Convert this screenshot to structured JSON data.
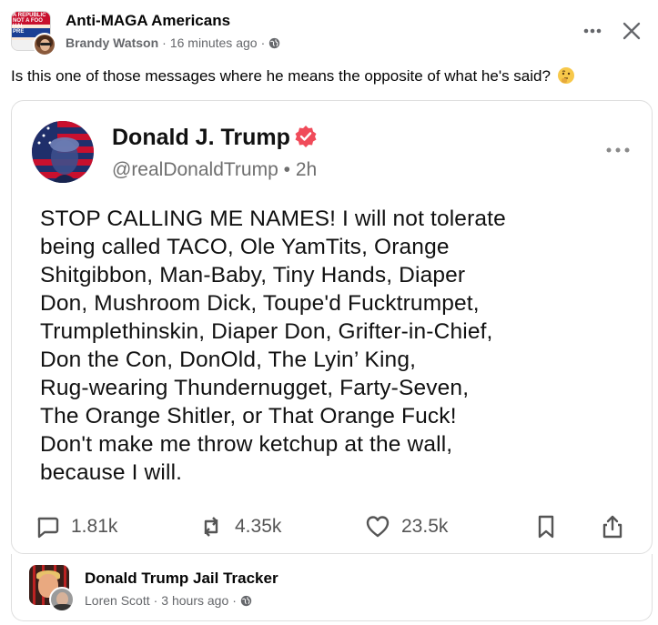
{
  "post": {
    "group_name": "Anti-MAGA Americans",
    "author": "Brandy Watson",
    "separator": "·",
    "time": "16 minutes ago",
    "separator2": "·",
    "caption": "Is this one of those messages where he means the opposite of what he's said?",
    "caption_emoji_icon": "thinking-face-icon",
    "group_avatar_text": "A REPUBLIC\nNOT A FOO\nHAI\nPRE"
  },
  "truth_post": {
    "name": "Donald J. Trump",
    "handle": "@realDonaldTrump",
    "bullet": "•",
    "time": "2h",
    "lines": [
      "STOP CALLING ME NAMES! I will not tolerate",
      "being called TACO, Ole YamTits, Orange",
      "Shitgibbon, Man-Baby, Tiny Hands, Diaper",
      "Don, Mushroom Dick, Toupe'd Fucktrumpet,",
      "Trumplethinskin, Diaper Don, Grifter-in-Chief,",
      "Don the Con, DonOld, The Lyin’ King,",
      "Rug-wearing Thundernugget, Farty-Seven,",
      "The Orange Shitler, or That Orange Fuck!",
      "Don't make me throw ketchup at the wall,",
      "because I will."
    ],
    "replies": "1.81k",
    "retruths": "4.35k",
    "likes": "23.5k"
  },
  "footer": {
    "page_name": "Donald Trump Jail Tracker",
    "author": "Loren Scott",
    "separator": "·",
    "time": "3 hours ago",
    "separator2": "·"
  },
  "colors": {
    "verified": "#f04b5a",
    "meta_text": "#65676b",
    "action_gray": "#555555"
  }
}
